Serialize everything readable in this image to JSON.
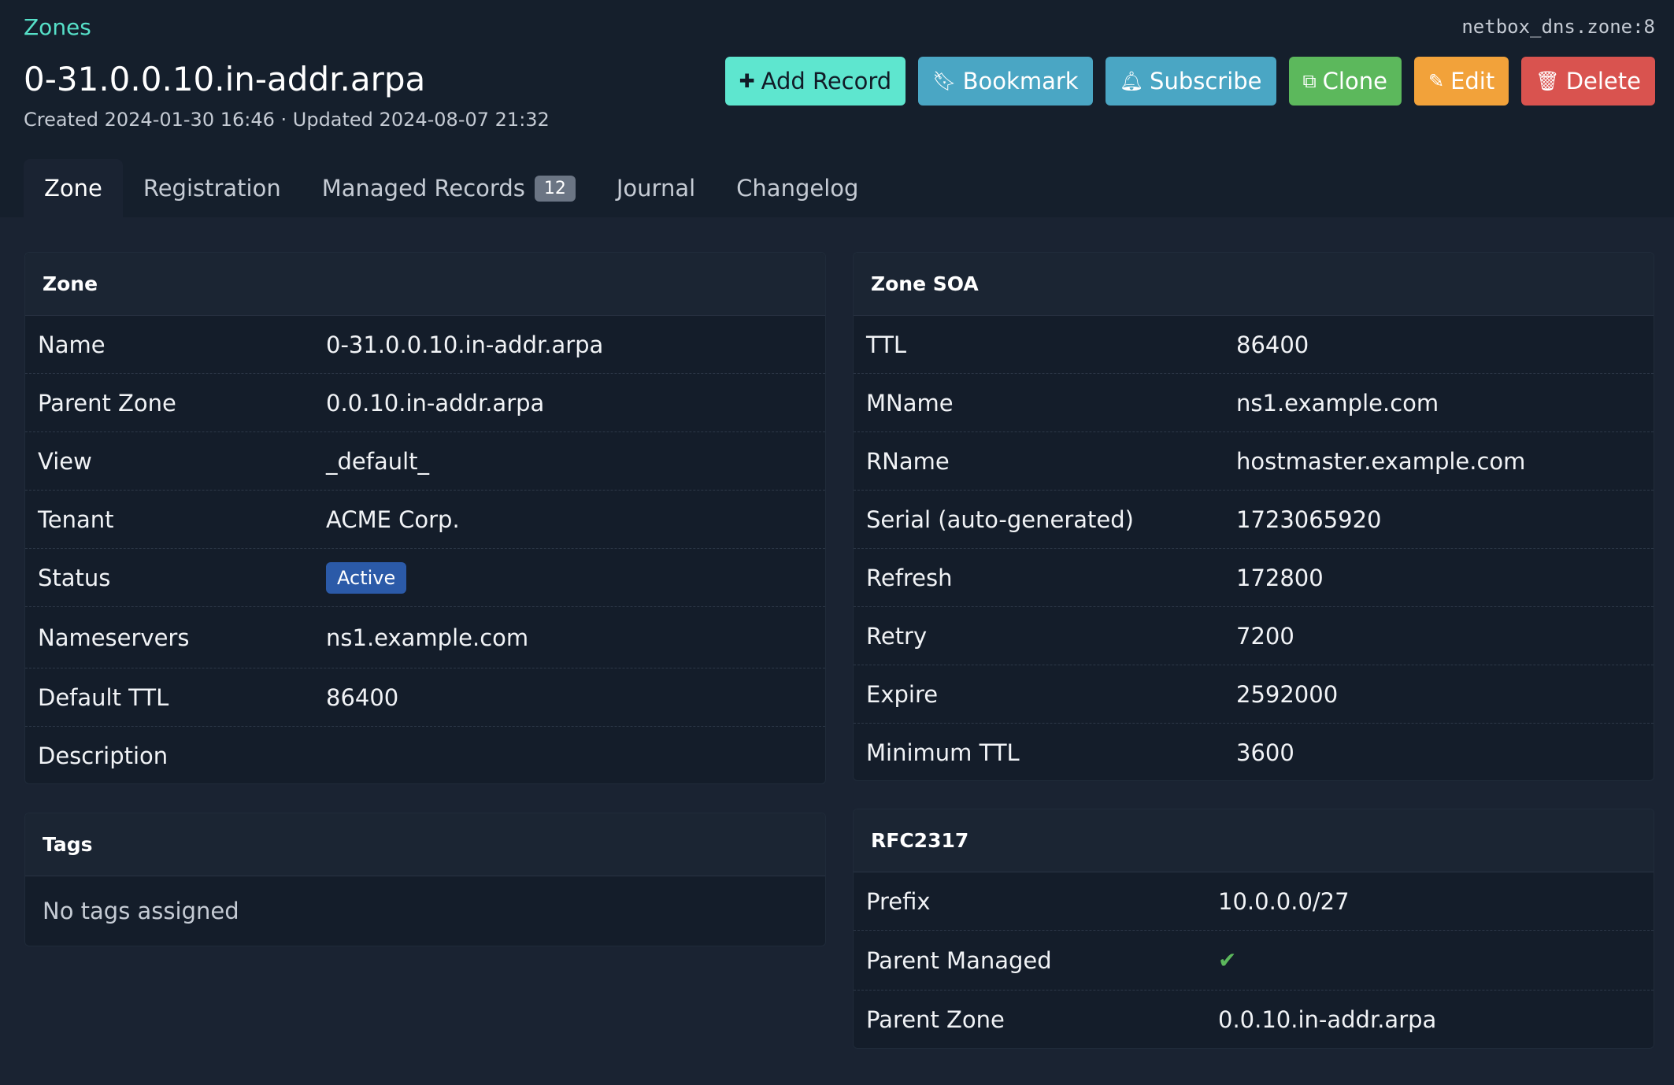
{
  "breadcrumb": "Zones",
  "object_id": "netbox_dns.zone:8",
  "title": "0-31.0.0.10.in-addr.arpa",
  "meta": "Created 2024-01-30 16:46 · Updated 2024-08-07 21:32",
  "actions": {
    "add_record": "Add Record",
    "bookmark": "Bookmark",
    "subscribe": "Subscribe",
    "clone": "Clone",
    "edit": "Edit",
    "delete": "Delete"
  },
  "tabs": {
    "zone": "Zone",
    "registration": "Registration",
    "managed_records": "Managed Records",
    "managed_records_count": "12",
    "journal": "Journal",
    "changelog": "Changelog"
  },
  "zone_card": {
    "title": "Zone",
    "name_label": "Name",
    "name_value": "0-31.0.0.10.in-addr.arpa",
    "parent_label": "Parent Zone",
    "parent_value": "0.0.10.in-addr.arpa",
    "view_label": "View",
    "view_value": "_default_",
    "tenant_label": "Tenant",
    "tenant_value": "ACME Corp.",
    "status_label": "Status",
    "status_value": "Active",
    "ns_label": "Nameservers",
    "ns_value": "ns1.example.com",
    "ttl_label": "Default TTL",
    "ttl_value": "86400",
    "desc_label": "Description",
    "desc_value": ""
  },
  "tags_card": {
    "title": "Tags",
    "empty": "No tags assigned"
  },
  "soa_card": {
    "title": "Zone SOA",
    "ttl_label": "TTL",
    "ttl_value": "86400",
    "mname_label": "MName",
    "mname_value": "ns1.example.com",
    "rname_label": "RName",
    "rname_value": "hostmaster.example.com",
    "serial_label": "Serial (auto-generated)",
    "serial_value": "1723065920",
    "refresh_label": "Refresh",
    "refresh_value": "172800",
    "retry_label": "Retry",
    "retry_value": "7200",
    "expire_label": "Expire",
    "expire_value": "2592000",
    "min_label": "Minimum TTL",
    "min_value": "3600"
  },
  "rfc_card": {
    "title": "RFC2317",
    "prefix_label": "Prefix",
    "prefix_value": "10.0.0.0/27",
    "managed_label": "Parent Managed",
    "managed_value": "✔",
    "parent_label": "Parent Zone",
    "parent_value": "0.0.10.in-addr.arpa"
  },
  "colors": {
    "accent": "#56e0c8",
    "background": "#1a2332",
    "card": "#141d2a",
    "status_active": "#2b5aa8"
  }
}
